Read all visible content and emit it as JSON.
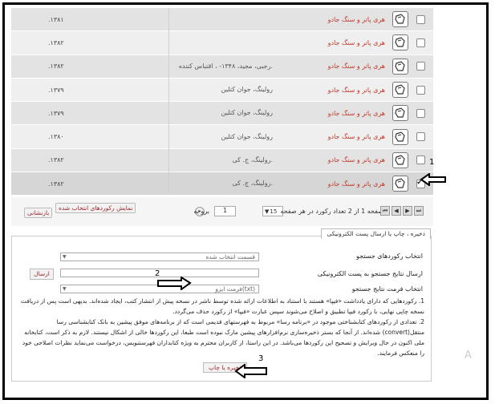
{
  "rows": [
    {
      "title": "هری پاتر و سنگ جادو",
      "author": "",
      "date": ".۱۳۸۱",
      "checked": false
    },
    {
      "title": "هری پاتر و سنگ جادو",
      "author": "",
      "date": ".۱۳۸۲",
      "checked": false
    },
    {
      "title": "هری پاتر و سنگ جادو",
      "author": "رجبی، مجید، ۱۳۴۸- ، اقتباس کننده.",
      "date": ".۱۳۸۲",
      "checked": false
    },
    {
      "title": "هری پاتر و سنگ جادو",
      "author": "رولینگ، جوان کتلین",
      "date": ".۱۳۷۹",
      "checked": false
    },
    {
      "title": "هری پاتر و سنگ جادو",
      "author": "رولینگ، جوان کتلین",
      "date": ".۱۳۷۹",
      "checked": false
    },
    {
      "title": "هری پاتر و سنگ جادو",
      "author": "رولینگ، جوان کتلین",
      "date": ".۱۳۸۰",
      "checked": false
    },
    {
      "title": "هری پاتر و سنگ جادو",
      "author": "رولینگ، ج. کی.",
      "date": ".۱۳۸۲",
      "checked": false
    },
    {
      "title": "هری پاتر و سنگ جادو",
      "author": "رولینگ، ج. کی.",
      "date": ".۱۳۸۲",
      "checked": true
    }
  ],
  "pager": {
    "text": "صفحه 1 از 2 تعداد رکورد در هر صفحه",
    "per_page": "15",
    "goto_label": "برو به",
    "page_value": "1",
    "show_selected": "نمایش رکوردهای انتخاب شده",
    "reset": "بازنشانی"
  },
  "panel": {
    "tab": "ذخیره ، چاپ یا ارسال پست الکترونیکی",
    "select_records_label": "انتخاب رکوردهای جستجو",
    "select_records_value": "قسمت انتخاب شده",
    "email_label": "ارسال نتایج جستجو به پست الکترونیکی",
    "send_button": "ارسال",
    "format_label": "انتخاب فرمت نتایج جستجو",
    "format_value": "فرمت ایزو(txt)",
    "note1": "1. رکوردهایی که دارای یادداشت «فیپا» هستند با استناد به اطلاعات ارائه شده توسط ناشر در نسخه پیش از انتشار کتب، ایجاد شده‌اند. بدیهی است پس از دریافت نسخه چاپی نهایی، با رکورد فیپا تطبیق و اصلاح می‌شوند سپس عبارت «فیپا» از رکورد حذف می‌گردد.",
    "note2": "2. تعدادی از رکوردهای کتابشناختی موجود در «برنامه رسا» مربوط به فهرستهای قدیمی است که از برنامه‌های موفق پیشین به بانک کتابشناسی رسا منتقل(convert) شده‌اند. از آنجا که بستر ذخیره‌سازی نرم‌افزارهای پیشین مارک نبوده است طبعا، این رکوردها خالی از اشکال نیستند. لازم به ذکر است، کتابخانه ملی اکنون در حال ویرایش و تصحیح این رکوردها می‌باشد. در این راستا، از کاربران محترم به ویژه کتابداران فهرستنویس، درخواست می‌نماید نظرات اصلاحی خود را منعکس فرمایند.",
    "save_button": "ذخیره یا چاپ"
  },
  "callouts": {
    "one": "1",
    "two": "2",
    "three": "3"
  },
  "colors": {
    "accent": "#c0392b",
    "row_odd": "#e3e3e3",
    "row_even": "#efefef"
  }
}
